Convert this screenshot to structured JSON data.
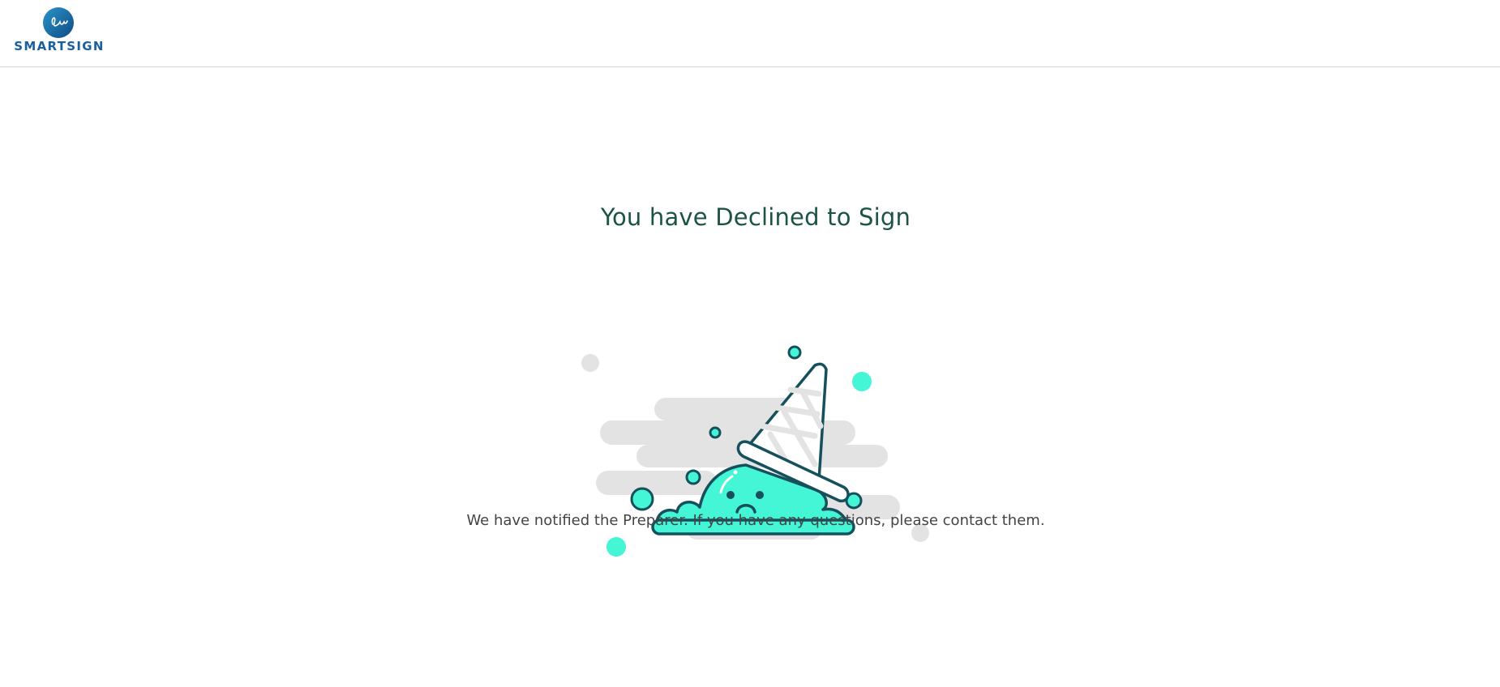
{
  "header": {
    "logo_text": "SMARTSIGN",
    "logo_icon": "signature-icon",
    "brand_color": "#1a5f9e"
  },
  "main": {
    "title": "You have Declined to Sign",
    "illustration_icon": "dropped-ice-cream-icon",
    "message": "We have notified the Preparer. If you have any questions, please contact them."
  },
  "colors": {
    "title": "#1b5446",
    "accent_mint": "#44f5d6",
    "outline": "#15505c",
    "cloud_gray": "#e3e3e3",
    "divider": "#d4d4d4"
  }
}
